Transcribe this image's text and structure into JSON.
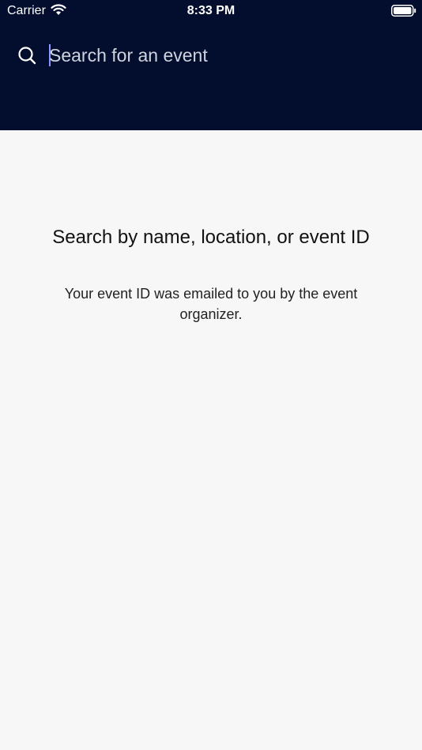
{
  "status_bar": {
    "carrier": "Carrier",
    "time": "8:33 PM",
    "wifi_icon": "wifi-icon",
    "battery_icon": "battery-icon"
  },
  "search": {
    "icon": "search-icon",
    "placeholder": "Search for an event",
    "value": ""
  },
  "empty_state": {
    "title": "Search by name, location, or event ID",
    "subtitle": "Your event ID was emailed to you by the event organizer."
  },
  "colors": {
    "header_bg": "#030e2e",
    "content_bg": "#f7f7f7",
    "cursor": "#8d95ff"
  }
}
